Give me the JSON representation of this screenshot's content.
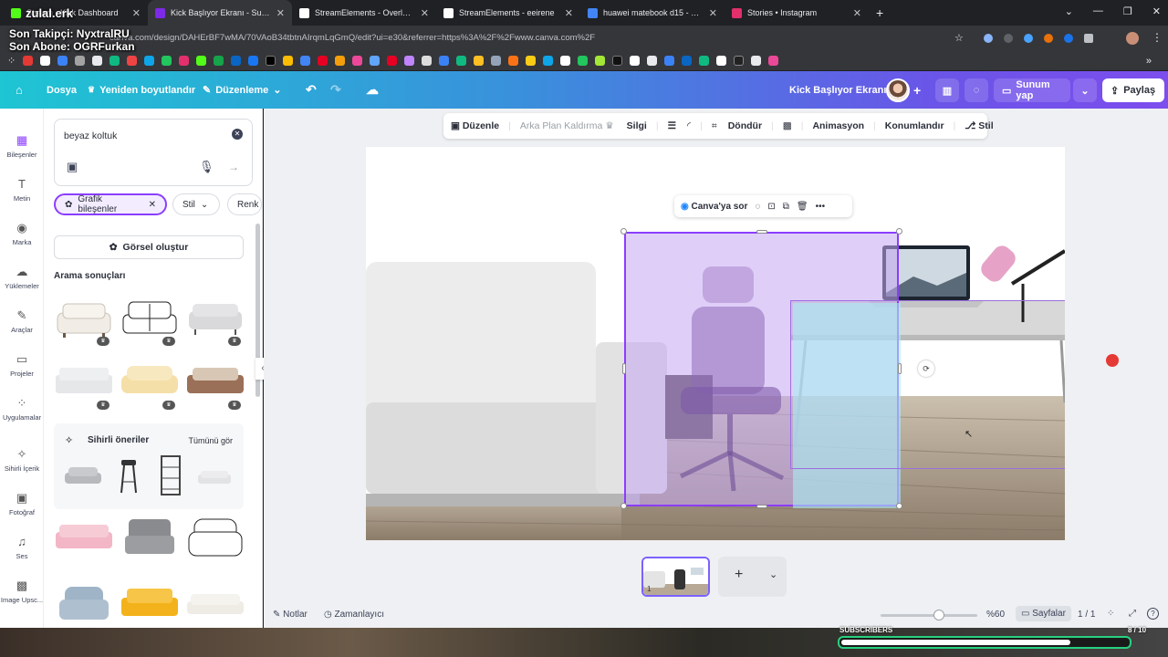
{
  "browser": {
    "tabs": [
      {
        "title": "Stream - Kick Dashboard",
        "color": "#53fc18",
        "active": false
      },
      {
        "title": "Kick Başlıyor Ekranı - Sunum",
        "color": "#7d2ae8",
        "active": true
      },
      {
        "title": "StreamElements - Overlays",
        "color": "#ffffff",
        "active": false
      },
      {
        "title": "StreamElements - eeirene",
        "color": "#ffffff",
        "active": false
      },
      {
        "title": "huawei matebook d15 - Google",
        "color": "#4285f4",
        "active": false
      },
      {
        "title": "Stories • Instagram",
        "color": "#e1306c",
        "active": false
      }
    ],
    "url": "canva.com/design/DAHErBF7wMA/70VAoB34tbtnAIrqmLqGmQ/edit?ui=e30&referrer=https%3A%2F%2Fwww.canva.com%2F"
  },
  "stream_overlay": {
    "brand": "zulal.erk",
    "follower_line": "Son Takipçi: NyxtralRU",
    "subscriber_line": "Son Abone: OGRFurkan",
    "subs_label": "SUBSCRIBERS",
    "subs_count": "8 / 10",
    "subs_progress": 0.8
  },
  "topbar": {
    "file": "Dosya",
    "resize": "Yeniden boyutlandır",
    "edit": "Düzenleme",
    "doc_title": "Kick Başlıyor Ekranı",
    "present": "Sunum yap",
    "share": "Paylaş"
  },
  "rail": [
    {
      "label": "Bileşenler",
      "icon": "elements-icon",
      "glyph": "▦"
    },
    {
      "label": "Metin",
      "icon": "text-icon",
      "glyph": "T"
    },
    {
      "label": "Marka",
      "icon": "brand-icon",
      "glyph": "◉"
    },
    {
      "label": "Yüklemeler",
      "icon": "upload-icon",
      "glyph": "☁"
    },
    {
      "label": "Araçlar",
      "icon": "tools-icon",
      "glyph": "✎"
    },
    {
      "label": "Projeler",
      "icon": "folder-icon",
      "glyph": "▭"
    },
    {
      "label": "Uygulamalar",
      "icon": "apps-icon",
      "glyph": "⁘"
    },
    {
      "label": "Sihirli İçerik",
      "icon": "magic-icon",
      "glyph": "✧"
    },
    {
      "label": "Fotoğraf",
      "icon": "photo-icon",
      "glyph": "▣"
    },
    {
      "label": "Ses",
      "icon": "music-icon",
      "glyph": "♫"
    },
    {
      "label": "Image Upsc...",
      "icon": "upscale-icon",
      "glyph": "▩"
    }
  ],
  "panel": {
    "search_value": "beyaz koltuk",
    "chips": [
      "Grafik bileşenler",
      "Stil",
      "Renk"
    ],
    "generate": "Görsel oluştur",
    "results_heading": "Arama sonuçları",
    "magic_heading": "Sihirli öneriler",
    "see_all": "Tümünü gör"
  },
  "context_toolbar": {
    "edit": "Düzenle",
    "bg_remove": "Arka Plan Kaldırma",
    "erase": "Silgi",
    "rotate": "Döndür",
    "animate": "Animasyon",
    "position": "Konumlandır",
    "style": "Stil"
  },
  "floating_toolbar": {
    "ask": "Canva'ya sor"
  },
  "bottom": {
    "notes": "Notlar",
    "timer": "Zamanlayıcı",
    "zoom": "%60",
    "zoom_level": 0.6,
    "pages": "Sayfalar",
    "page_count": "1 / 1",
    "page_number": "1"
  }
}
